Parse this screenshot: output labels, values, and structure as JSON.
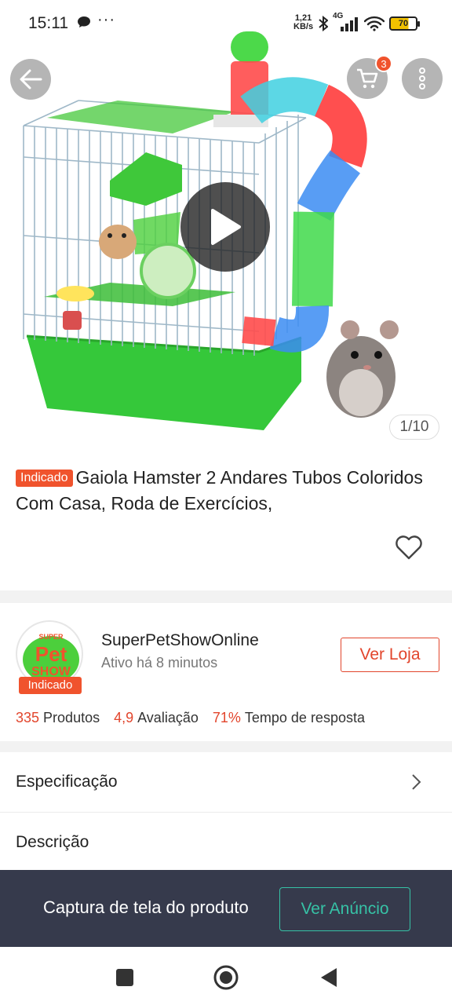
{
  "status_bar": {
    "time": "15:11",
    "speed_value": "1,21",
    "speed_unit": "KB/s",
    "network": "4G",
    "battery": "70",
    "icons": [
      "chat-bubble-icon",
      "more-dots-icon",
      "bluetooth-icon",
      "signal-icon",
      "wifi-icon",
      "battery-icon"
    ]
  },
  "top_nav": {
    "icons": [
      "back-arrow-icon",
      "cart-icon",
      "more-vertical-icon"
    ],
    "cart_badge": "3"
  },
  "media": {
    "page_counter": "1/10",
    "play_icon": "play-icon"
  },
  "product": {
    "tag": "Indicado",
    "title": "Gaiola Hamster 2 Andares Tubos Coloridos Com Casa, Roda de Exercícios,",
    "favorite_icon": "heart-outline-icon"
  },
  "seller": {
    "name": "SuperPetShowOnline",
    "active": "Ativo há 8 minutos",
    "tag": "Indicado",
    "logo_text_top": "SUPER",
    "logo_text_mid": "Pet",
    "logo_text_bot": "SHOW",
    "visit_button": "Ver Loja",
    "stats": [
      {
        "value": "335",
        "label": "Produtos"
      },
      {
        "value": "4,9",
        "label": "Avaliação"
      },
      {
        "value": "71%",
        "label": "Tempo de resposta"
      }
    ]
  },
  "sections": {
    "spec": "Especificação",
    "desc": "Descrição"
  },
  "banner": {
    "text": "Captura de tela do produto",
    "button": "Ver Anúncio"
  },
  "colors": {
    "accent": "#f0532d",
    "banner_bg": "#363a4c",
    "banner_button": "#36c2a6"
  },
  "nav_bar": {
    "icons": [
      "recents-square-icon",
      "home-circle-icon",
      "back-triangle-icon"
    ]
  }
}
